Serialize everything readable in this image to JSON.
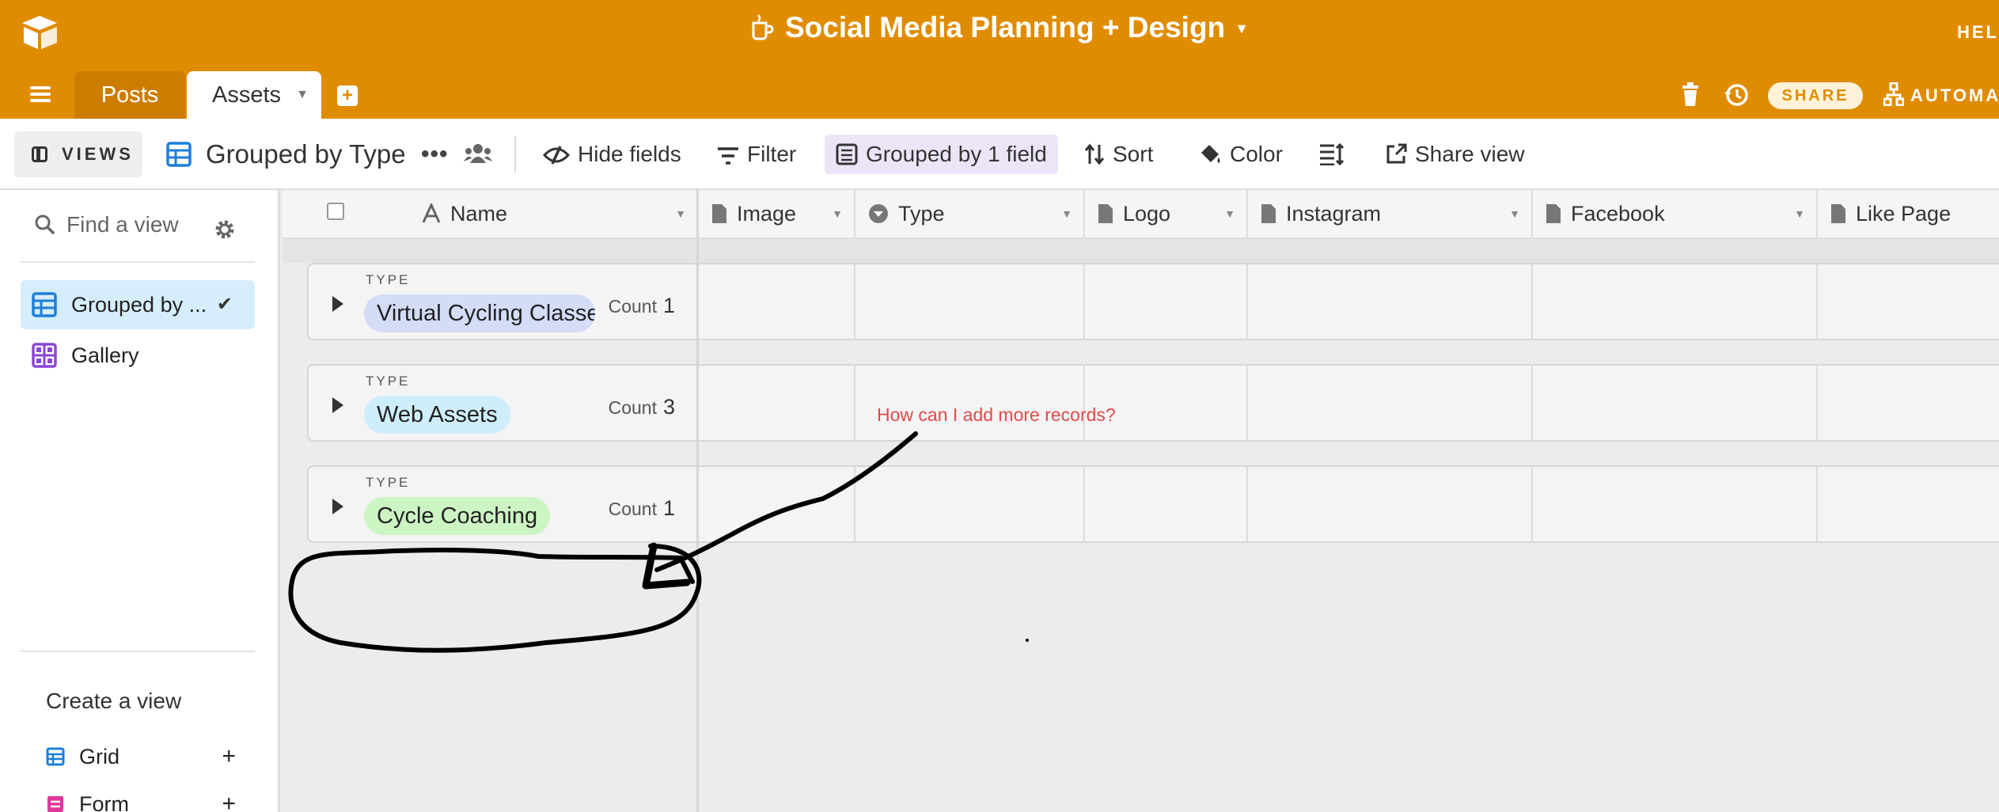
{
  "app": {
    "base_title": "Social Media Planning + Design",
    "help_label": "HEL",
    "share_label": "SHARE",
    "automate_label": "AUTOMAT"
  },
  "tabs": {
    "posts": "Posts",
    "assets": "Assets"
  },
  "toolbar": {
    "views_label": "VIEWS",
    "view_name": "Grouped by Type",
    "hide_fields": "Hide fields",
    "filter": "Filter",
    "grouped": "Grouped by 1 field",
    "sort": "Sort",
    "color": "Color",
    "share_view": "Share view"
  },
  "sidebar": {
    "search_placeholder": "Find a view",
    "views": [
      {
        "label": "Grouped by ...",
        "icon": "grid-icon",
        "active": true
      },
      {
        "label": "Gallery",
        "icon": "gallery-icon",
        "active": false
      }
    ],
    "create_title": "Create a view",
    "create_items": [
      {
        "label": "Grid",
        "icon": "grid-icon"
      },
      {
        "label": "Form",
        "icon": "form-icon"
      }
    ]
  },
  "columns": [
    {
      "label": "Name",
      "icon": "text-field-icon"
    },
    {
      "label": "Image",
      "icon": "attachment-icon"
    },
    {
      "label": "Type",
      "icon": "single-select-icon"
    },
    {
      "label": "Logo",
      "icon": "attachment-icon"
    },
    {
      "label": "Instagram",
      "icon": "attachment-icon"
    },
    {
      "label": "Facebook",
      "icon": "attachment-icon"
    },
    {
      "label": "Like Page",
      "icon": "attachment-icon"
    }
  ],
  "groups": [
    {
      "type_label": "TYPE",
      "value": "Virtual Cycling Classes",
      "count_label": "Count",
      "count": "1",
      "color": "#d4dcf8"
    },
    {
      "type_label": "TYPE",
      "value": "Web Assets",
      "count_label": "Count",
      "count": "3",
      "color": "#cfeefb"
    },
    {
      "type_label": "TYPE",
      "value": "Cycle Coaching",
      "count_label": "Count",
      "count": "1",
      "color": "#cdf5c4"
    }
  ],
  "annotation": "How can I add more records?",
  "colors": {
    "brand": "#e08c00",
    "annotation": "#e04a4a"
  }
}
